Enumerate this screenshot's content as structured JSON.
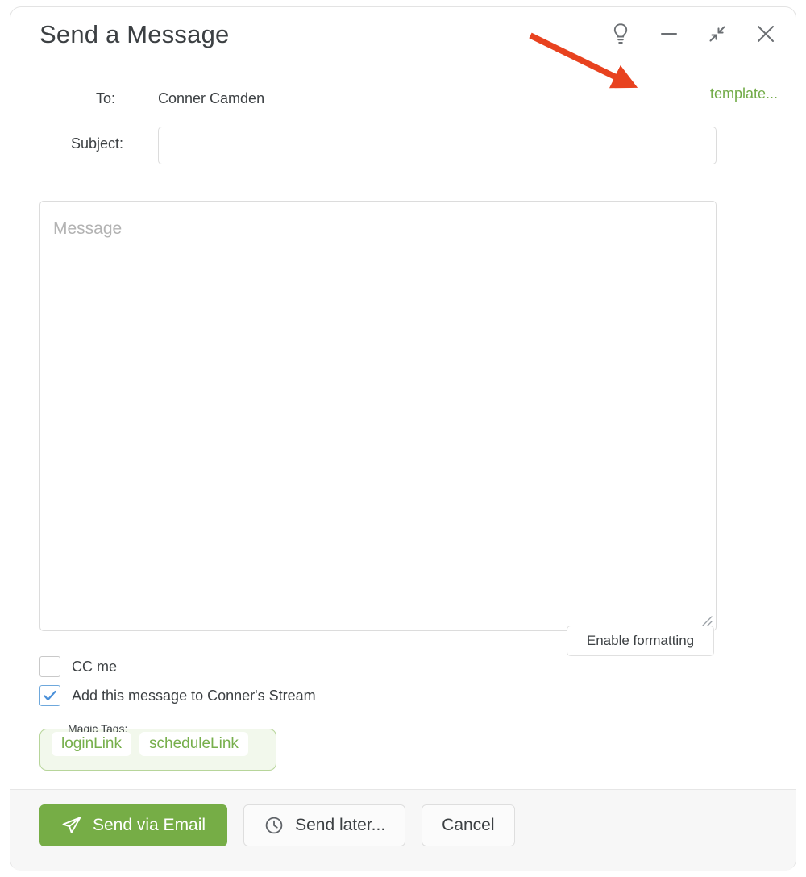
{
  "window": {
    "title": "Send a Message",
    "controls": [
      {
        "name": "lightbulb-icon",
        "label": "Tips"
      },
      {
        "name": "minimize-icon",
        "label": "Minimize"
      },
      {
        "name": "collapse-icon",
        "label": "Restore"
      },
      {
        "name": "close-icon",
        "label": "Close"
      }
    ]
  },
  "form": {
    "to_label": "To:",
    "to_value": "Conner Camden",
    "template_link": "template...",
    "subject_label": "Subject:",
    "subject_value": "",
    "subject_placeholder": "",
    "message_value": "",
    "message_placeholder": "Message",
    "enable_formatting_label": "Enable formatting"
  },
  "checkboxes": [
    {
      "label": "CC me",
      "checked": false
    },
    {
      "label": "Add this message to Conner's Stream",
      "checked": true
    }
  ],
  "magic_tags": {
    "legend": "Magic Tags:",
    "tags": [
      "loginLink",
      "scheduleLink"
    ]
  },
  "footer": {
    "send_email_label": "Send via Email",
    "send_later_label": "Send later...",
    "cancel_label": "Cancel"
  },
  "colors": {
    "accent_green": "#76ad46",
    "link_green": "#72ab48",
    "tag_green": "#77af4c",
    "checkbox_blue": "#6ea8dc",
    "annotation_red": "#e8421f",
    "text": "#3c4043"
  },
  "annotation": {
    "type": "arrow",
    "points_to": "template..."
  }
}
